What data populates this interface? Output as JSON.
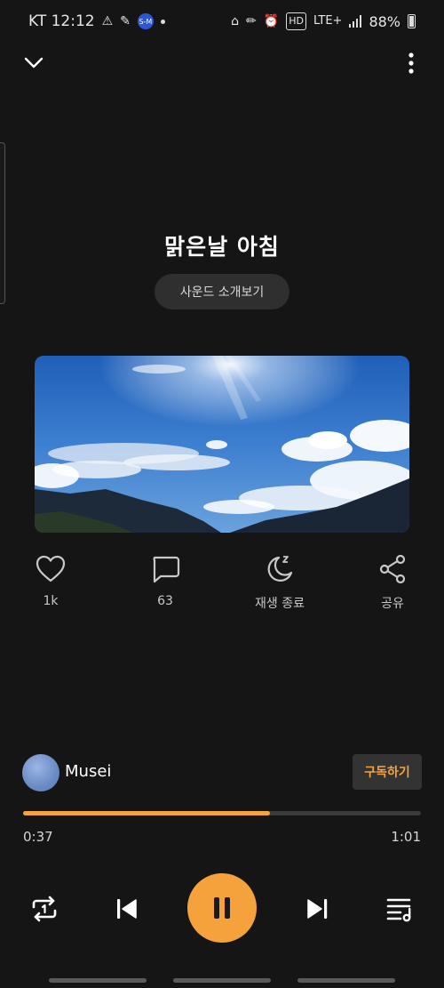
{
  "status_bar": {
    "carrier_time": "KT 12:12",
    "network": "LTE+",
    "hd": "HD",
    "battery": "88%",
    "pill_icon_text": "S-M"
  },
  "top": {
    "collapse_icon": "chevron-down-icon",
    "more_icon": "more-vertical-icon"
  },
  "track": {
    "title": "맑은날 아침",
    "intro_button": "사운드 소개보기"
  },
  "actions": [
    {
      "icon": "heart-icon",
      "label": "1k"
    },
    {
      "icon": "comment-icon",
      "label": "63"
    },
    {
      "icon": "sleep-timer-icon",
      "label": "재생 종료"
    },
    {
      "icon": "share-icon",
      "label": "공유"
    }
  ],
  "channel": {
    "name": "Musei",
    "subscribe_label": "구독하기"
  },
  "playback": {
    "elapsed": "0:37",
    "total": "1:01",
    "progress_fraction": 0.62,
    "progress_color": "#f5a23c"
  },
  "colors": {
    "background": "#151515",
    "accent": "#f5a23c"
  }
}
